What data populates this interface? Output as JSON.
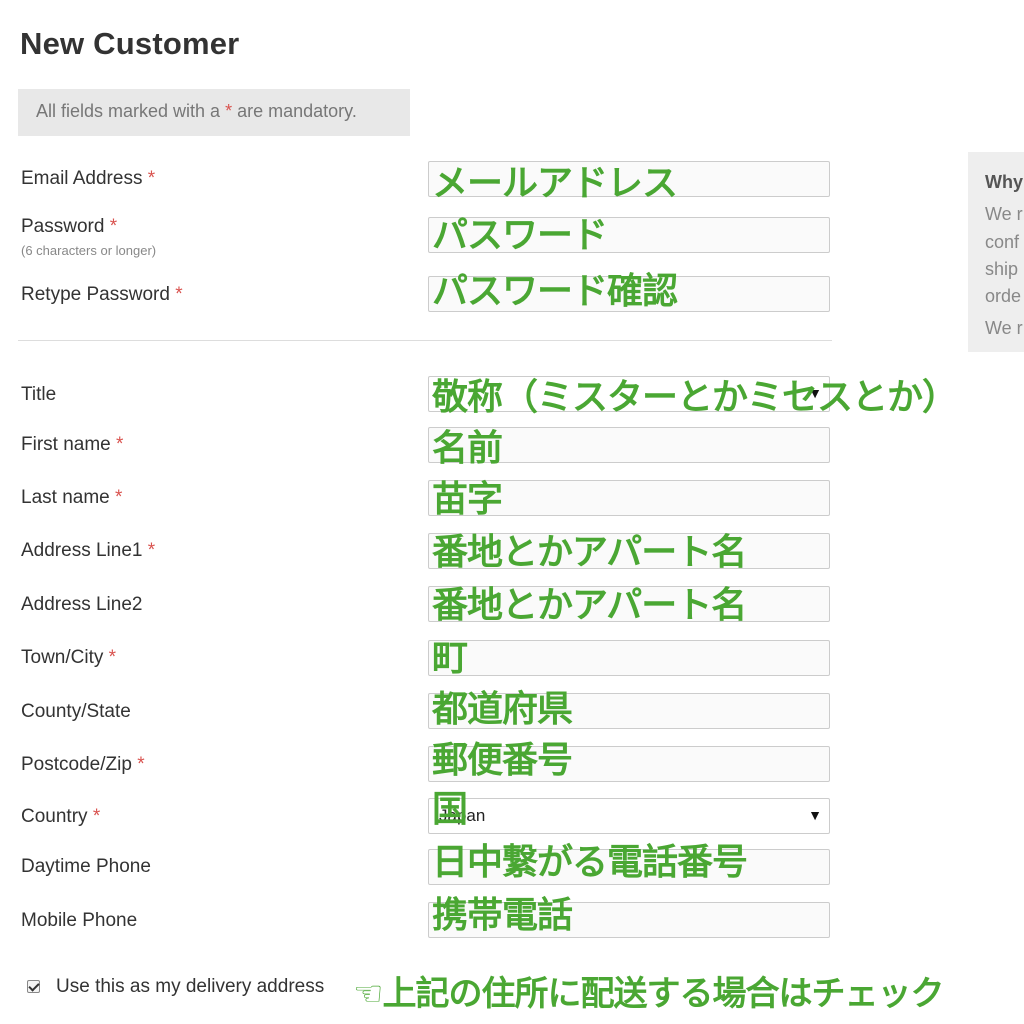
{
  "header": {
    "title": "New Customer"
  },
  "notice": {
    "prefix": "All fields marked with a ",
    "asterisk": "*",
    "suffix": " are mandatory."
  },
  "fields": {
    "email": {
      "label": "Email Address",
      "required": "*",
      "annotation": "メールアドレス"
    },
    "password": {
      "label": "Password",
      "required": "*",
      "hint": "(6 characters or longer)",
      "annotation": "パスワード"
    },
    "retype_password": {
      "label": "Retype Password",
      "required": "*",
      "annotation": "パスワード確認"
    },
    "title": {
      "label": "Title",
      "annotation": "敬称（ミスターとかミセスとか）"
    },
    "first_name": {
      "label": "First name",
      "required": "*",
      "annotation": "名前"
    },
    "last_name": {
      "label": "Last name",
      "required": "*",
      "annotation": "苗字"
    },
    "address_line1": {
      "label": "Address Line1",
      "required": "*",
      "annotation": "番地とかアパート名"
    },
    "address_line2": {
      "label": "Address Line2",
      "annotation": "番地とかアパート名"
    },
    "town_city": {
      "label": "Town/City",
      "required": "*",
      "annotation": "町"
    },
    "county_state": {
      "label": "County/State",
      "annotation": "都道府県"
    },
    "postcode_zip": {
      "label": "Postcode/Zip",
      "required": "*",
      "annotation": "郵便番号"
    },
    "country": {
      "label": "Country",
      "required": "*",
      "value": "Japan",
      "annotation": "国"
    },
    "daytime_phone": {
      "label": "Daytime Phone",
      "annotation": "日中繋がる電話番号"
    },
    "mobile_phone": {
      "label": "Mobile Phone",
      "annotation": "携帯電話"
    }
  },
  "side_panel": {
    "title": "Why",
    "lines": [
      "We r",
      "conf",
      "ship",
      "orde",
      "We r"
    ]
  },
  "delivery": {
    "checked": true,
    "label": "Use this as my delivery address",
    "annotation": "☜上記の住所に配送する場合はチェック"
  },
  "colors": {
    "annotation_green": "#4aa733",
    "required_red": "#d9534f"
  }
}
